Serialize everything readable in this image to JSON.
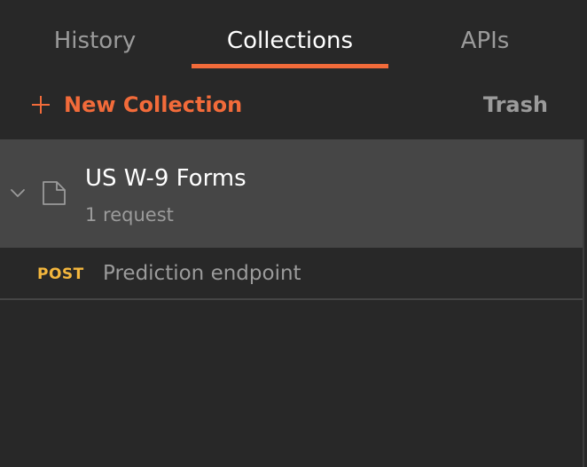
{
  "tabs": [
    {
      "label": "History",
      "active": false
    },
    {
      "label": "Collections",
      "active": true
    },
    {
      "label": "APIs",
      "active": false
    }
  ],
  "actions": {
    "new_collection_label": "New Collection",
    "trash_label": "Trash"
  },
  "collection": {
    "name": "US W-9 Forms",
    "meta": "1 request",
    "expanded": true,
    "chevron_icon": "chevron-down-icon",
    "folder_icon": "folder-icon"
  },
  "requests": [
    {
      "method": "POST",
      "name": "Prediction endpoint"
    }
  ],
  "colors": {
    "background": "#282828",
    "accent": "#f26b3a",
    "collection_bg": "#464646",
    "post_method": "#f4b73d",
    "text_active": "#ffffff",
    "text_muted": "#9b9b9b"
  }
}
